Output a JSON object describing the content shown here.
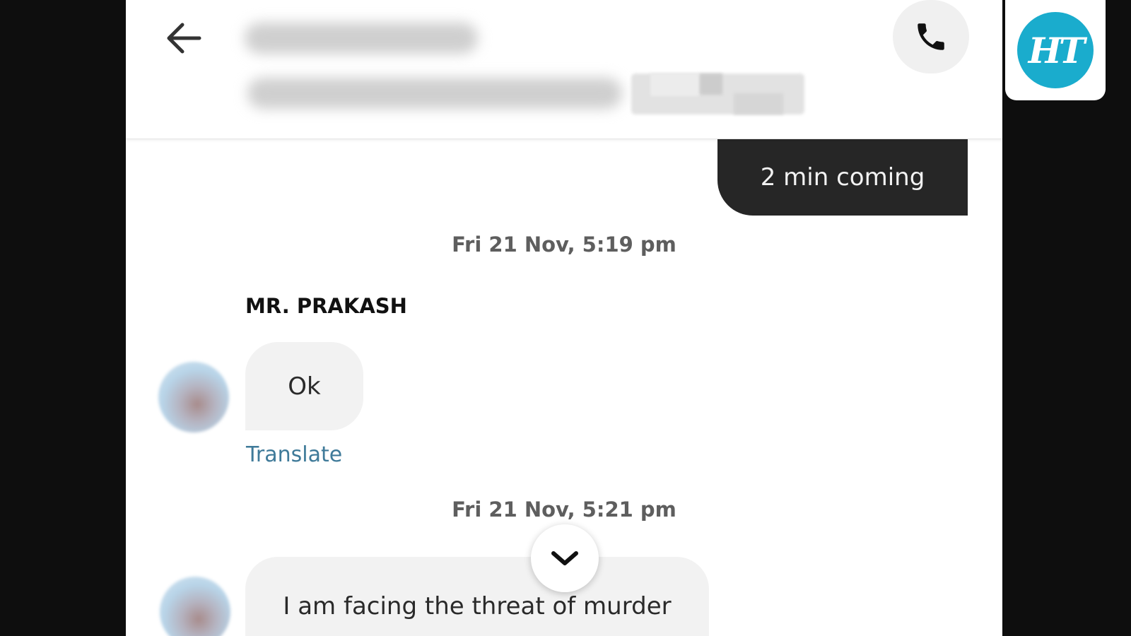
{
  "header": {
    "back_icon": "arrow-left-icon",
    "call_icon": "phone-icon"
  },
  "messages": {
    "sent_1": "2 min coming",
    "timestamp_1": "Fri 21 Nov, 5:19 pm",
    "sender_name": "MR. PRAKASH",
    "received_1": "Ok",
    "translate_label": "Translate",
    "timestamp_2": "Fri 21 Nov, 5:21 pm",
    "received_2": "I am facing the threat of murder",
    "scroll_icon": "chevron-down-icon"
  },
  "branding": {
    "logo_text": "HT",
    "logo_color": "#1aaccd"
  },
  "colors": {
    "sent_bubble": "#262626",
    "received_bubble": "#f2f2f2",
    "link": "#3f7a99"
  }
}
